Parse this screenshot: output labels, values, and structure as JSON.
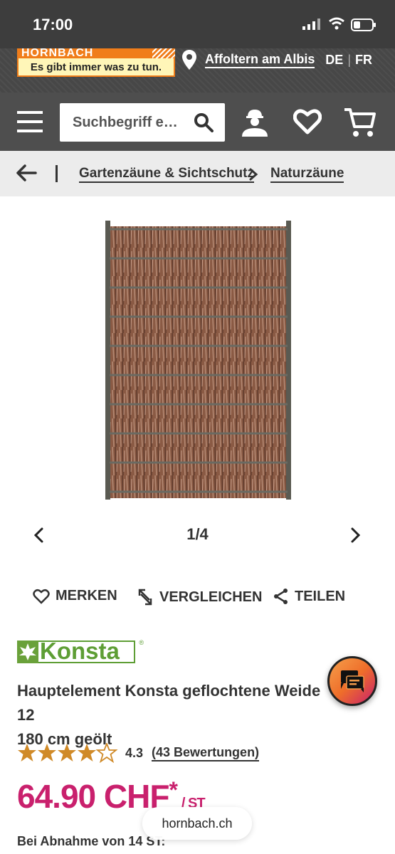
{
  "status_bar": {
    "time": "17:00"
  },
  "header": {
    "logo_top": "HORNBACH",
    "logo_slogan": "Es gibt immer was zu tun.",
    "location": "Affoltern am Albis",
    "lang_de": "DE",
    "lang_fr": "FR"
  },
  "search": {
    "placeholder": "Suchbegriff e…"
  },
  "breadcrumb": {
    "item1": "Gartenzäune & Sichtschutz",
    "item2": "Naturzäune"
  },
  "gallery": {
    "counter": "1/4"
  },
  "actions": {
    "remember": "MERKEN",
    "compare": "VERGLEICHEN",
    "share": "TEILEN"
  },
  "product": {
    "brand": "Konsta",
    "title": "Hauptelement Konsta geflochtene Weide 12",
    "title_line2": "180 cm geölt",
    "rating_value": "4.3",
    "rating_count": "(43 Bewertungen)",
    "rating_stars": 4.3,
    "price": "64.90 CHF",
    "price_star": "*",
    "price_unit": "/ ST",
    "bulk_text": "Bei Abnahme von 14 ST:"
  },
  "browser": {
    "url": "hornbach.ch"
  },
  "colors": {
    "price": "#c9206d",
    "brand_orange": "#f07d1a",
    "star": "#d08a28",
    "konsta_green": "#5e9e35"
  }
}
